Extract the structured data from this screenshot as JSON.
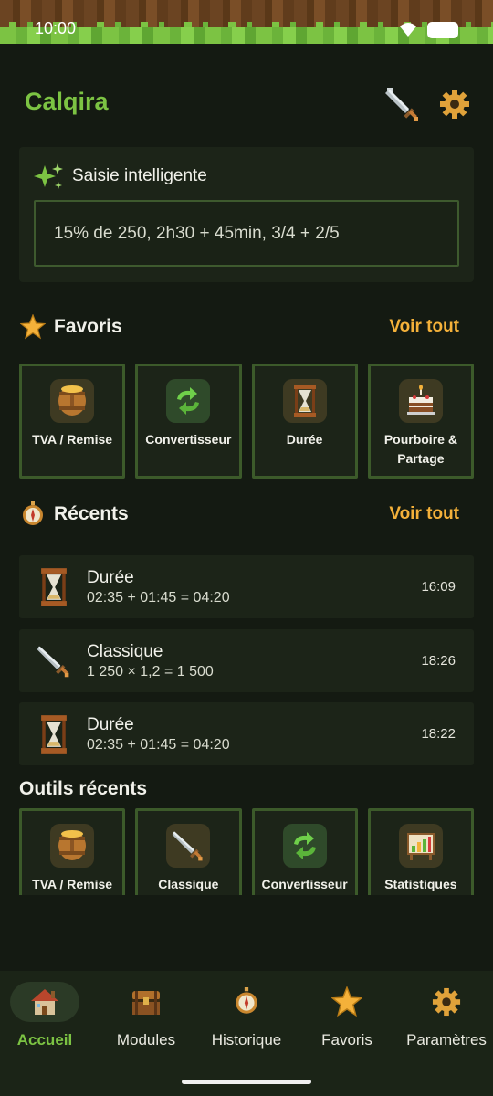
{
  "status": {
    "time": "10:00"
  },
  "header": {
    "title": "Calqira",
    "icons": [
      "sword-icon",
      "gear-icon"
    ]
  },
  "smart_input": {
    "title": "Saisie intelligente",
    "placeholder": "15% de 250, 2h30 + 45min, 3/4 + 2/5"
  },
  "favorites": {
    "title": "Favoris",
    "see_all": "Voir tout",
    "items": [
      {
        "label": "TVA / Remise",
        "icon": "barrel-icon"
      },
      {
        "label": "Convertisseur",
        "icon": "convert-arrows-icon"
      },
      {
        "label": "Durée",
        "icon": "hourglass-icon"
      },
      {
        "label": "Pourboire & Partage",
        "icon": "cake-icon"
      }
    ]
  },
  "recents": {
    "title": "Récents",
    "see_all": "Voir tout",
    "items": [
      {
        "title": "Durée",
        "expr": "02:35 + 01:45 = 04:20",
        "time": "16:09",
        "icon": "hourglass-icon"
      },
      {
        "title": "Classique",
        "expr": "1 250 × 1,2 = 1 500",
        "time": "18:26",
        "icon": "sword-icon"
      },
      {
        "title": "Durée",
        "expr": "02:35 + 01:45 = 04:20",
        "time": "18:22",
        "icon": "hourglass-icon"
      }
    ]
  },
  "recent_tools": {
    "title": "Outils récents",
    "items": [
      {
        "label": "TVA / Remise",
        "icon": "barrel-icon"
      },
      {
        "label": "Classique",
        "icon": "sword-icon"
      },
      {
        "label": "Convertisseur",
        "icon": "convert-arrows-icon"
      },
      {
        "label": "Statistiques",
        "icon": "chart-icon"
      }
    ]
  },
  "nav": {
    "active": "Accueil",
    "items": [
      {
        "label": "Accueil",
        "icon": "house-icon"
      },
      {
        "label": "Modules",
        "icon": "chest-icon"
      },
      {
        "label": "Historique",
        "icon": "compass-icon"
      },
      {
        "label": "Favoris",
        "icon": "star-icon"
      },
      {
        "label": "Paramètres",
        "icon": "gear-icon"
      }
    ]
  },
  "colors": {
    "accent_green": "#7cc343",
    "accent_orange": "#f4b13a",
    "background": "#141a12",
    "card": "#1c2418"
  }
}
